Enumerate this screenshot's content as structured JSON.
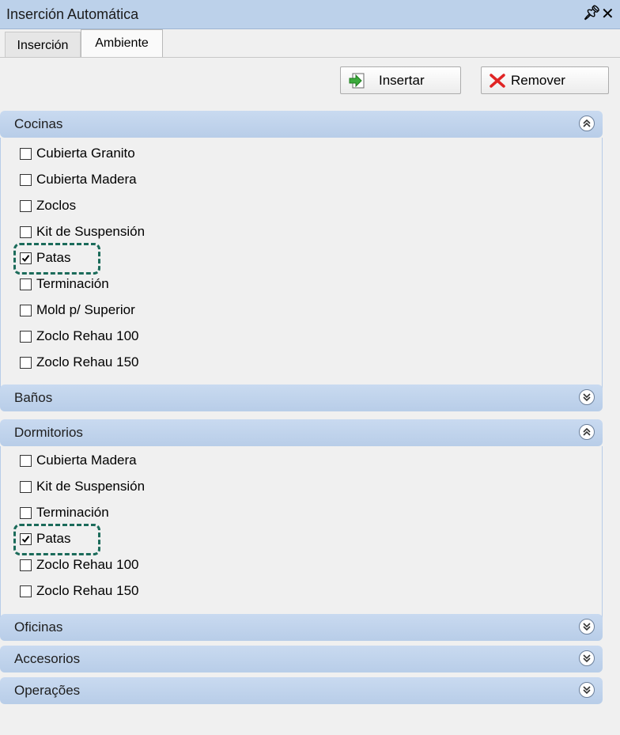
{
  "window": {
    "title": "Inserción Automática",
    "pin_icon": "pin-icon",
    "close_icon": "close-icon"
  },
  "tabs": [
    {
      "label": "Inserción",
      "active": false
    },
    {
      "label": "Ambiente",
      "active": true
    }
  ],
  "toolbar": {
    "insert_label": "Insertar",
    "remove_label": "Remover"
  },
  "panels": [
    {
      "title": "Cocinas",
      "expanded": true,
      "items": [
        {
          "label": "Cubierta Granito",
          "checked": false
        },
        {
          "label": "Cubierta Madera",
          "checked": false
        },
        {
          "label": "Zoclos",
          "checked": false
        },
        {
          "label": "Kit de Suspensión",
          "checked": false
        },
        {
          "label": "Patas",
          "checked": true
        },
        {
          "label": "Terminación",
          "checked": false
        },
        {
          "label": "Mold p/ Superior",
          "checked": false
        },
        {
          "label": "Zoclo Rehau 100",
          "checked": false
        },
        {
          "label": "Zoclo Rehau 150",
          "checked": false
        }
      ]
    },
    {
      "title": "Baños",
      "expanded": false,
      "items": []
    },
    {
      "title": "Dormitorios",
      "expanded": true,
      "items": [
        {
          "label": "Cubierta Madera",
          "checked": false
        },
        {
          "label": "Kit de Suspensión",
          "checked": false
        },
        {
          "label": "Terminación",
          "checked": false
        },
        {
          "label": "Patas",
          "checked": true
        },
        {
          "label": "Zoclo Rehau 100",
          "checked": false
        },
        {
          "label": "Zoclo Rehau 150",
          "checked": false
        }
      ]
    },
    {
      "title": "Oficinas",
      "expanded": false,
      "items": []
    },
    {
      "title": "Accesorios",
      "expanded": false,
      "items": []
    },
    {
      "title": "Operações",
      "expanded": false,
      "items": []
    }
  ],
  "colors": {
    "header": "#bcd1ea",
    "panel_header": "#c3d5ee",
    "highlight": "#1b6b5a"
  }
}
